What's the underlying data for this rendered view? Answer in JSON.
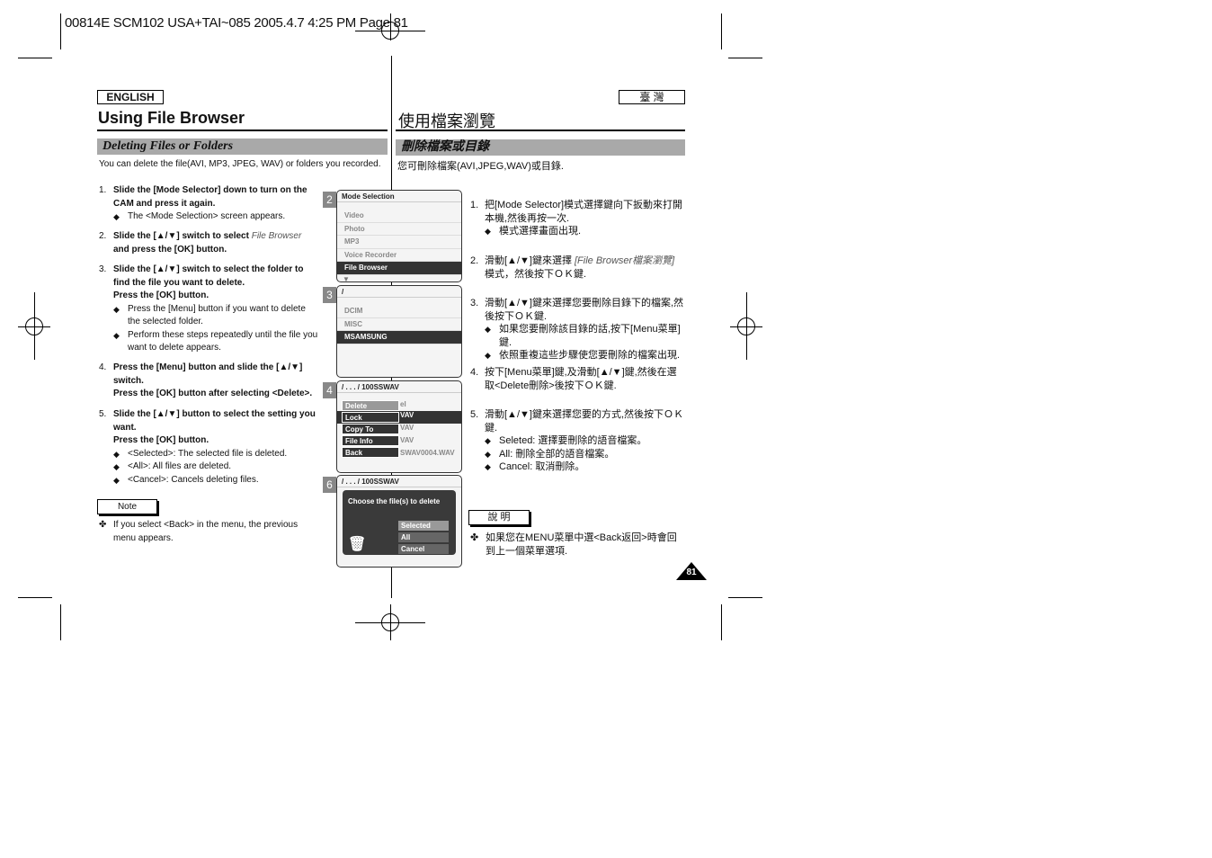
{
  "slug": "00814E SCM102 USA+TAI~085 2005.4.7 4:25 PM Page 81",
  "left": {
    "lang": "ENGLISH",
    "title": "Using File Browser",
    "section": "Deleting Files or Folders",
    "intro": "You can delete the file(AVI, MP3, JPEG, WAV) or folders you recorded.",
    "steps": [
      {
        "n": "1.",
        "text": "Slide the [Mode Selector] down to turn on the CAM and press it again.",
        "subs": [
          "The <Mode Selection> screen appears."
        ]
      },
      {
        "n": "2.",
        "text": "Slide the [▲/▼] switch to select ",
        "em": "File Browser",
        "text2": " and press the [OK] button.",
        "subs": []
      },
      {
        "n": "3.",
        "text": "Slide the [▲/▼] switch to select the folder to find the file you want to delete.",
        "text2": "Press the [OK] button.",
        "subs": [
          "Press the [Menu] button if you want to delete the selected folder.",
          "Perform these steps repeatedly until the file you want to delete appears."
        ]
      },
      {
        "n": "4.",
        "text": "Press the [Menu] button and slide the [▲/▼] switch.",
        "text2": "Press the [OK] button after selecting <Delete>.",
        "subs": []
      },
      {
        "n": "5.",
        "text": "Slide the [▲/▼] button to select the setting you want.",
        "text2": "Press the [OK] button.",
        "subs": [
          "<Selected>: The selected file is deleted.",
          "<All>: All files are deleted.",
          "<Cancel>: Cancels deleting files."
        ]
      }
    ],
    "note_label": "Note",
    "note": "If you select <Back> in the menu, the previous menu appears."
  },
  "right": {
    "lang": "臺 灣",
    "title": "使用檔案瀏覽",
    "section": "刪除檔案或目錄",
    "intro": "您可刪除檔案(AVI,JPEG,WAV)或目錄.",
    "steps": [
      {
        "n": "1.",
        "text": "把[Mode Selector]模式選擇鍵向下扳動來打開本機,然後再按一次.",
        "subs": [
          "模式選擇畫面出現."
        ]
      },
      {
        "n": "2.",
        "text": "滑動[▲/▼]鍵來選擇 ",
        "em": "[File Browser檔案瀏覽]",
        "text2": "模式，然後按下ＯＫ鍵.",
        "subs": []
      },
      {
        "n": "3.",
        "text": "滑動[▲/▼]鍵來選擇您要刪除目錄下的檔案,然後按下ＯＫ鍵.",
        "subs": [
          "如果您要刪除該目錄的話,按下[Menu菜單]鍵.",
          "依照重複這些步驟使您要刪除的檔案出現."
        ]
      },
      {
        "n": "4.",
        "text": "按下[Menu菜單]鍵,及滑動[▲/▼]鍵,然後在選取<Delete刪除>後按下ＯＫ鍵.",
        "subs": []
      },
      {
        "n": "5.",
        "text": "滑動[▲/▼]鍵來選擇您要的方式,然後按下ＯＫ鍵.",
        "subs": [
          "Seleted: 選擇要刪除的語音檔案。",
          "All: 刪除全部的語音檔案。",
          "Cancel: 取消刪除。"
        ]
      }
    ],
    "note_label": "說 明",
    "note": "如果您在MENU菜單中選<Back返回>時會回到上一個菜單選項."
  },
  "screens": {
    "s2": {
      "num": "2",
      "title": "Mode Selection",
      "items": [
        "Video",
        "Photo",
        "MP3",
        "Voice Recorder",
        "File Browser"
      ]
    },
    "s3": {
      "num": "3",
      "title": "/",
      "items": [
        "DCIM",
        "MISC",
        "MSAMSUNG"
      ]
    },
    "s4": {
      "num": "4",
      "title": "/ . . . / 100SSWAV",
      "menu": [
        "Delete",
        "Lock",
        "Copy To",
        "File Info",
        "Back"
      ],
      "bg": [
        "el",
        "VAV",
        "VAV",
        "VAV",
        "SWAV0004.WAV"
      ]
    },
    "s6": {
      "num": "6",
      "title": "/ . . . / 100SSWAV",
      "prompt": "Choose the file(s) to delete",
      "options": [
        "Selected",
        "All",
        "Cancel"
      ]
    }
  },
  "page_number": "81"
}
